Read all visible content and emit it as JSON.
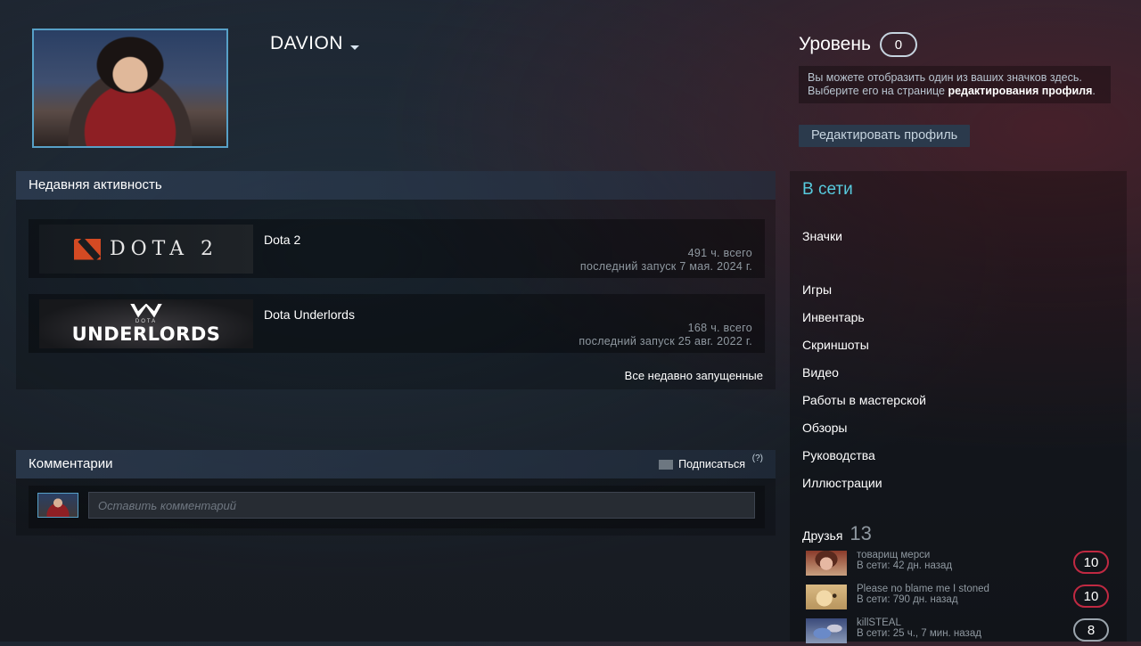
{
  "profile": {
    "name": "DAVION",
    "level_label": "Уровень",
    "level_value": "0",
    "badge_note_before": "Вы можете отобразить один из ваших значков здесь. Выберите его на странице ",
    "badge_note_bold": "редактирования профиля",
    "badge_note_after": ".",
    "edit_button": "Редактировать профиль"
  },
  "recent_activity": {
    "title": "Недавняя активность",
    "games": [
      {
        "name": "Dota 2",
        "hours": "491 ч. всего",
        "last_played": "последний запуск 7 мая. 2024 г.",
        "logo_text": "DOTA 2"
      },
      {
        "name": "Dota Underlords",
        "hours": "168 ч. всего",
        "last_played": "последний запуск 25 авг. 2022 г.",
        "logo_small": "DOTA",
        "logo_text": "UNDERLORDS"
      }
    ],
    "all_recent_link": "Все недавно запущенные"
  },
  "comments": {
    "title": "Комментарии",
    "subscribe_label": "Подписаться",
    "help": "(?)",
    "input_placeholder": "Оставить комментарий"
  },
  "sidebar": {
    "status": "В сети",
    "colors": {
      "status": "#57cbde",
      "level_ring_red": "#c02942",
      "level_ring_gray": "#9ba5ad"
    },
    "links": [
      {
        "label": "Значки"
      },
      {
        "label": "Игры"
      },
      {
        "label": "Инвентарь"
      },
      {
        "label": "Скриншоты"
      },
      {
        "label": "Видео"
      },
      {
        "label": "Работы в мастерской"
      },
      {
        "label": "Обзоры"
      },
      {
        "label": "Руководства"
      },
      {
        "label": "Иллюстрации"
      }
    ],
    "friends_label": "Друзья",
    "friends_count": "13",
    "friends": [
      {
        "name": "товарищ мерси",
        "status": "В сети: 42 дн. назад",
        "level": "10"
      },
      {
        "name": "Please no blame me I stoned",
        "status": "В сети: 790 дн. назад",
        "level": "10"
      },
      {
        "name": "killSTEAL",
        "status": "В сети: 25 ч., 7 мин. назад",
        "level": "8"
      }
    ]
  }
}
